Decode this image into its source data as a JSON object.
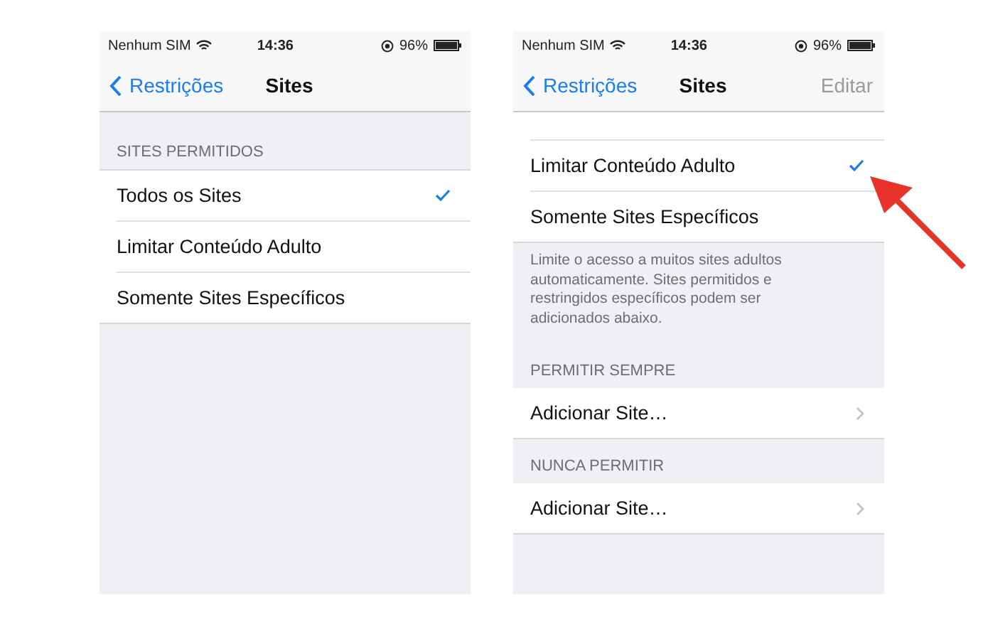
{
  "screens": [
    {
      "status": {
        "carrier": "Nenhum SIM",
        "time": "14:36",
        "battery": "96%"
      },
      "nav": {
        "back": "Restrições",
        "title": "Sites"
      },
      "scrolled": false,
      "sections": [
        {
          "header": "SITES PERMITIDOS",
          "rows": [
            {
              "kind": "check",
              "label": "Todos os Sites",
              "selected": true
            },
            {
              "kind": "check",
              "label": "Limitar Conteúdo Adulto",
              "selected": false
            },
            {
              "kind": "check",
              "label": "Somente Sites Específicos",
              "selected": false
            }
          ]
        }
      ]
    },
    {
      "status": {
        "carrier": "Nenhum SIM",
        "time": "14:36",
        "battery": "96%"
      },
      "nav": {
        "back": "Restrições",
        "title": "Sites",
        "action": {
          "label": "Editar",
          "disabled": true
        }
      },
      "scrolled": true,
      "sections": [
        {
          "rows": [
            {
              "kind": "check",
              "label": "Limitar Conteúdo Adulto",
              "selected": true
            },
            {
              "kind": "check",
              "label": "Somente Sites Específicos",
              "selected": false
            }
          ],
          "footer": "Limite o acesso a muitos sites adultos automaticamente. Sites permitidos e restringidos específicos podem ser adicionados abaixo."
        },
        {
          "header": "PERMITIR SEMPRE",
          "rows": [
            {
              "kind": "link",
              "label": "Adicionar Site…"
            }
          ]
        },
        {
          "header": "NUNCA PERMITIR",
          "rows": [
            {
              "kind": "link",
              "label": "Adicionar Site…"
            }
          ]
        }
      ]
    }
  ]
}
